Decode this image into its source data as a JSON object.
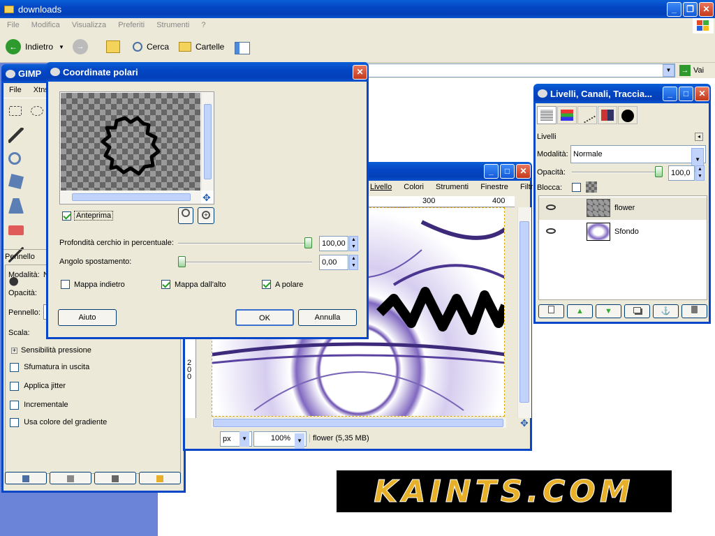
{
  "explorer": {
    "title": "downloads",
    "menu": [
      "File",
      "Modifica",
      "Visualizza",
      "Preferiti",
      "Strumenti",
      "?"
    ],
    "toolbar": {
      "back": "Indietro",
      "search": "Cerca",
      "folders": "Cartelle"
    },
    "go": "Vai"
  },
  "gimp_toolbox": {
    "title": "GIMP",
    "menu": [
      "File",
      "Xtns"
    ],
    "tool_options_title": "Pennello",
    "labels": {
      "mode": "Modalità:",
      "mode_value": "N",
      "opacity": "Opacità:",
      "brush": "Pennello:",
      "scale": "Scala:"
    },
    "options": [
      {
        "label": "Sensibilità pressione",
        "expander": true
      },
      {
        "label": "Sfumatura in uscita",
        "checked": false
      },
      {
        "label": "Applica jitter",
        "checked": false
      },
      {
        "label": "Incrementale",
        "checked": false
      },
      {
        "label": "Usa colore del gradiente",
        "checked": false
      }
    ]
  },
  "dialog": {
    "title": "Coordinate polari",
    "preview_label": "Anteprima",
    "preview_checked": true,
    "depth_label": "Profondità cerchio in percentuale:",
    "depth_value": "100,00",
    "depth_fraction": 1.0,
    "angle_label": "Angolo spostamento:",
    "angle_value": "0,00",
    "angle_fraction": 0.0,
    "check_backwards": {
      "label": "Mappa indietro",
      "checked": false
    },
    "check_top": {
      "label": "Mappa dall'alto",
      "checked": true
    },
    "check_polar": {
      "label": "A polare",
      "checked": true
    },
    "help": "Aiuto",
    "ok": "OK",
    "cancel": "Annulla"
  },
  "image_window": {
    "menu": [
      "Livello",
      "Colori",
      "Strumenti",
      "Finestre",
      "Filtri"
    ],
    "ruler_ticks": [
      "300",
      "400"
    ],
    "vruler_text": "200",
    "unit": "px",
    "zoom": "100%",
    "status": "flower (5,35 MB)"
  },
  "layers": {
    "title": "Livelli, Canali, Traccia...",
    "section": "Livelli",
    "mode_label": "Modalità:",
    "mode_value": "Normale",
    "opacity_label": "Opacità:",
    "opacity_value": "100,0",
    "opacity_fraction": 1.0,
    "lock_label": "Blocca:",
    "items": [
      {
        "name": "flower",
        "visible": true
      },
      {
        "name": "Sfondo",
        "visible": true
      }
    ]
  },
  "banner": {
    "text": "KAINTS.COM"
  },
  "colors": {
    "xp_blue": "#0846c8",
    "dialog_bg": "#ece9d8",
    "purple": "#4a2f8a"
  }
}
